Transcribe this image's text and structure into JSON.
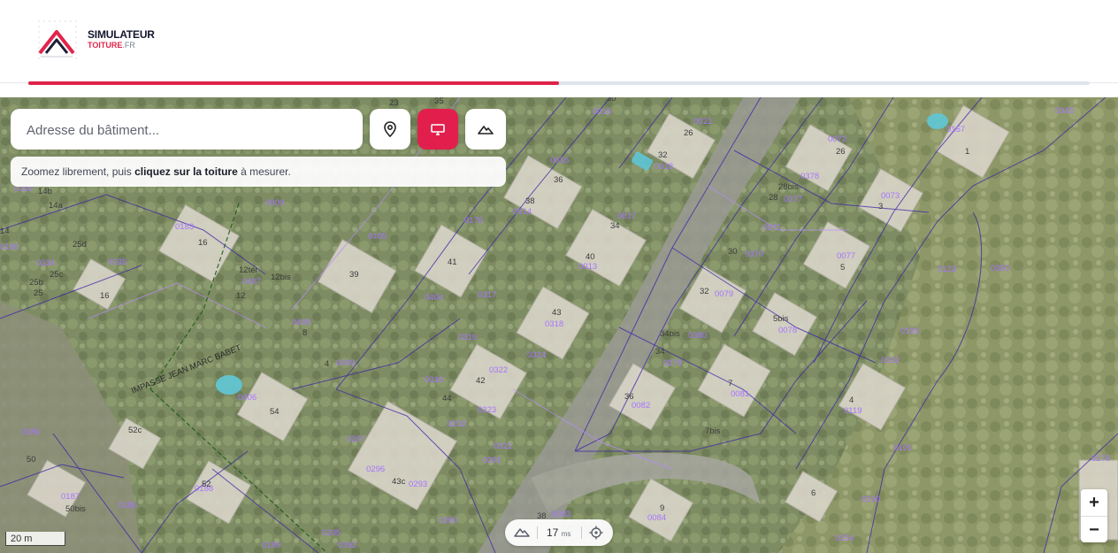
{
  "brand": {
    "title": "SIMULATEUR",
    "sub": "TOITURE",
    "tld": ".FR"
  },
  "progress": {
    "value_percent": 50
  },
  "search": {
    "placeholder": "Adresse du bâtiment..."
  },
  "toolbar": {
    "locate_icon": "map-pin-icon",
    "draw_icon": "roof-select-icon",
    "terrain_icon": "mountain-icon"
  },
  "hint": {
    "before": "Zoomez librement, puis ",
    "bold": "cliquez sur la toiture",
    "after": " à mesurer."
  },
  "scale": {
    "label": "20 m"
  },
  "zoom": {
    "in": "+",
    "out": "−"
  },
  "status": {
    "value": "17",
    "unit": "ms"
  },
  "street": {
    "name": "IMPASSE JEAN MARC BABET"
  },
  "parcels": [
    "0019",
    "0021",
    "0016",
    "0018",
    "0014",
    "0017",
    "0013",
    "0176",
    "0072",
    "0157",
    "0345",
    "0378",
    "0377",
    "0073",
    "0371",
    "0370",
    "0077",
    "0123",
    "0350",
    "0009",
    "0405",
    "0183",
    "0335",
    "0334",
    "0407",
    "0408",
    "0409",
    "0404",
    "0317",
    "0318",
    "0319",
    "0324",
    "0322",
    "0323",
    "0316",
    "0406",
    "0292",
    "0297",
    "0296",
    "0293",
    "0291",
    "0321",
    "0290",
    "0186",
    "0187",
    "0188",
    "0185",
    "0189",
    "0295",
    "0392",
    "0079",
    "0078",
    "0380",
    "0379",
    "0082",
    "0081",
    "0193",
    "0192",
    "0119",
    "0191",
    "0190",
    "0154",
    "0276",
    "0084",
    "0083",
    "0309",
    "0180"
  ],
  "numbers": [
    "23",
    "35",
    "30",
    "26",
    "32",
    "16",
    "36",
    "38",
    "34",
    "40",
    "26",
    "1",
    "28bis",
    "28",
    "3",
    "30",
    "5",
    "14b",
    "14a",
    "25d",
    "25c",
    "25b",
    "25",
    "16",
    "12ter",
    "12bis",
    "12",
    "39",
    "41",
    "43",
    "8",
    "4",
    "42",
    "44",
    "54",
    "52c",
    "52",
    "50",
    "50bis",
    "43c",
    "32",
    "5bis",
    "34bis",
    "34",
    "36",
    "7",
    "4",
    "7bis",
    "9",
    "6",
    "38",
    "14"
  ],
  "colors": {
    "accent": "#e21f4c",
    "parcel_line": "#5a2fbf",
    "parcel_label": "#b98cff"
  }
}
